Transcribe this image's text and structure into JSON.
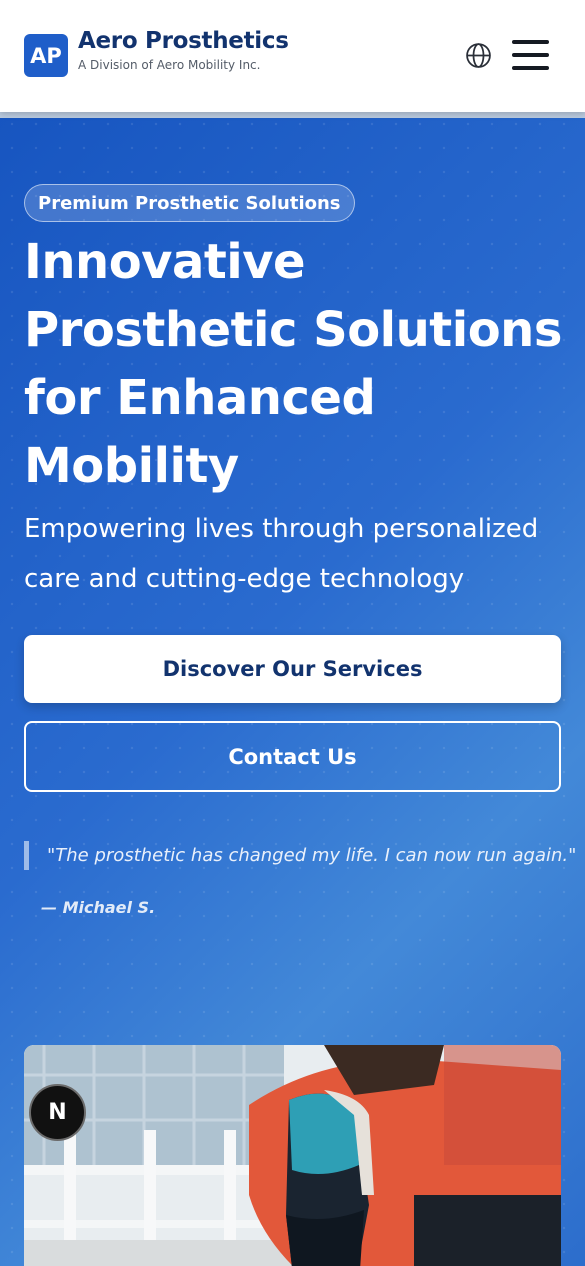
{
  "header": {
    "logo_text": "AP",
    "title": "Aero Prosthetics",
    "subtitle": "A Division of Aero Mobility Inc.",
    "language_icon": "globe-icon",
    "menu_icon": "hamburger-menu-icon"
  },
  "hero": {
    "badge": "Premium Prosthetic Solutions",
    "title_lines": [
      "Innovative",
      "Prosthetic Solutions",
      "for Enhanced",
      "Mobility"
    ],
    "subtitle_lines": [
      "Empowering lives through personalized",
      "care and cutting-edge technology"
    ],
    "primary_cta": "Discover Our Services",
    "secondary_cta": "Contact Us",
    "testimonial": {
      "quote": "\"The prosthetic has changed my life. I can now run again.\"",
      "author": "— Michael S."
    }
  },
  "floating_badge": "N",
  "colors": {
    "brand_blue": "#1f5ec9",
    "navy_text": "#12336e",
    "hero_gradient_start": "#1755c0",
    "hero_gradient_end": "#4389d8"
  }
}
